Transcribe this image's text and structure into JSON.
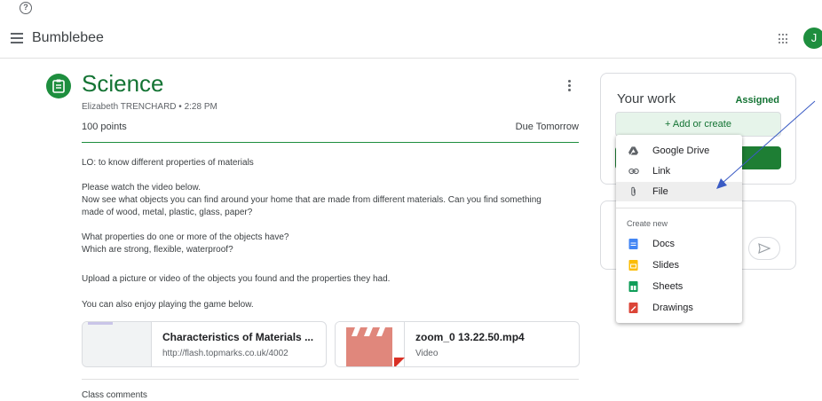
{
  "header": {
    "help_icon": "question-circle-icon",
    "app_name": "Bumblebee",
    "avatar_initial": "J"
  },
  "assignment": {
    "title": "Science",
    "author_time": "Elizabeth TRENCHARD • 2:28 PM",
    "points": "100 points",
    "due": "Due Tomorrow",
    "description": [
      "LO: to know different properties of materials",
      "Please watch the video below.",
      "Now see what objects you can find around your home that are made from different materials. Can you find something",
      "made of wood, metal, plastic, glass, paper?",
      "What properties do one or more of the objects have?",
      "Which are strong, flexible, waterproof?",
      "Upload a picture or video of the objects you found and the properties they had.",
      "You can also enjoy playing the game below."
    ]
  },
  "attachments": [
    {
      "title": "Characteristics of Materials ...",
      "subtitle": "http://flash.topmarks.co.uk/4002"
    },
    {
      "title": "zoom_0 13.22.50.mp4",
      "subtitle": "Video"
    }
  ],
  "class_comments_label": "Class comments",
  "your_work": {
    "title": "Your work",
    "status": "Assigned",
    "add_button": "+ Add or create"
  },
  "menu": {
    "items": [
      {
        "label": "Google Drive",
        "icon": "google-drive-icon"
      },
      {
        "label": "Link",
        "icon": "link-icon"
      },
      {
        "label": "File",
        "icon": "paperclip-icon"
      }
    ],
    "create_heading": "Create new",
    "create_items": [
      {
        "label": "Docs",
        "icon": "docs-icon",
        "color": "#4285f4"
      },
      {
        "label": "Slides",
        "icon": "slides-icon",
        "color": "#fbbc04"
      },
      {
        "label": "Sheets",
        "icon": "sheets-icon",
        "color": "#0f9d58"
      },
      {
        "label": "Drawings",
        "icon": "drawings-icon",
        "color": "#db4437"
      }
    ]
  },
  "colors": {
    "accent_green": "#1e8e3e",
    "title_green": "#137333",
    "annotation_arrow": "#3a5bc4"
  }
}
